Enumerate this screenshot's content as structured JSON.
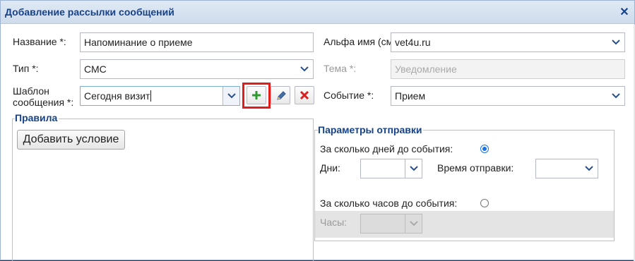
{
  "window": {
    "title": "Добавление рассылки сообщений",
    "close_icon": "close-icon"
  },
  "form": {
    "name_label": "Название *:",
    "name_value": "Напоминание о приеме",
    "type_label": "Тип *:",
    "type_value": "СМС",
    "template_label_line1": "Шаблон",
    "template_label_line2": "сообщения *:",
    "template_value": "Сегодня визит",
    "alpha_label": "Альфа имя (смс центр) *:",
    "alpha_value": "vet4u.ru",
    "subject_label": "Тема *:",
    "subject_placeholder": "Уведомление",
    "event_label": "Событие *:",
    "event_value": "Прием",
    "buttons": {
      "add_icon": "plus-icon",
      "edit_icon": "pencil-icon",
      "delete_icon": "x-icon"
    }
  },
  "rules": {
    "title": "Правила",
    "add_condition_label": "Добавить условие"
  },
  "send_params": {
    "title": "Параметры отправки",
    "days_before_label": "За сколько дней до события:",
    "days_before_selected": true,
    "days_label": "Дни:",
    "days_value": "",
    "send_time_label": "Время отправки:",
    "send_time_value": "",
    "hours_before_label": "За сколько часов до события:",
    "hours_before_selected": false,
    "hours_label": "Часы:",
    "hours_value": ""
  },
  "colors": {
    "title_text": "#15428b",
    "highlight": "#e21b1b",
    "add_green": "#2e9b2e",
    "delete_red": "#d42020"
  }
}
